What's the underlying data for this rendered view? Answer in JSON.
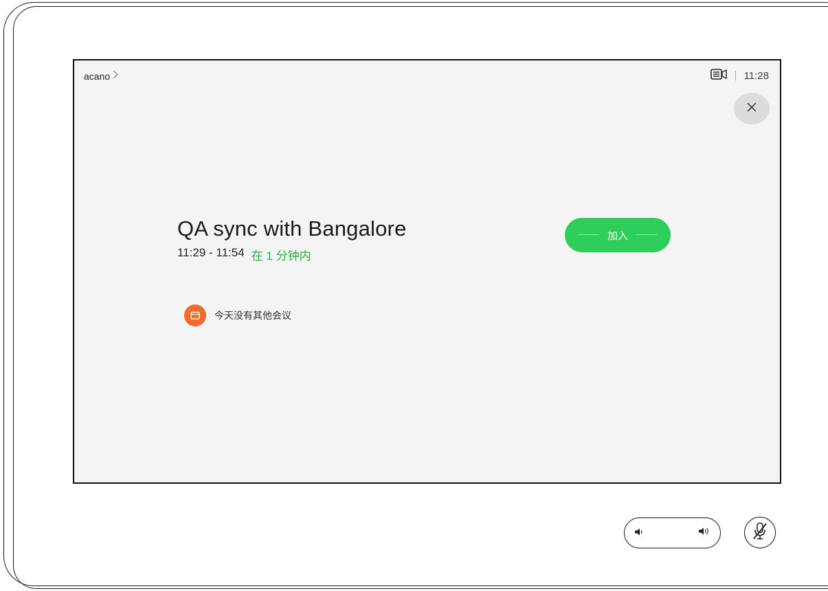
{
  "header": {
    "breadcrumb_label": "acano",
    "time": "11:28"
  },
  "meeting": {
    "title": "QA sync with Bangalore",
    "time_range": "11:29 - 11:54",
    "starts_in": "在 1 分钟内",
    "join_label": "加入"
  },
  "schedule": {
    "no_more_meetings": "今天没有其他会议"
  },
  "colors": {
    "accent_green": "#2fce5a",
    "soon_text_green": "#2daf4a",
    "calendar_badge": "#f26a2e",
    "screen_bg": "#f4f4f4"
  },
  "icons": {
    "breadcrumb": "chevron-right-icon",
    "status": "camera-controls-icon",
    "close": "close-icon",
    "calendar": "calendar-icon",
    "volume_down": "volume-down-icon",
    "volume_up": "volume-up-icon",
    "mute": "microphone-muted-icon"
  }
}
